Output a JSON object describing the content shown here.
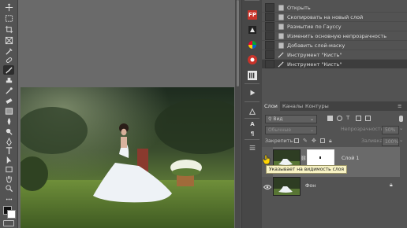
{
  "history": {
    "items": [
      {
        "label": "Открыть",
        "icon": "document-icon"
      },
      {
        "label": "Скопировать на новый слой",
        "icon": "document-icon"
      },
      {
        "label": "Размытие по Гауссу",
        "icon": "document-icon"
      },
      {
        "label": "Изменить основную непрозрачность",
        "icon": "document-icon"
      },
      {
        "label": "Добавить слой-маску",
        "icon": "document-icon"
      },
      {
        "label": "Инструмент \"Кисть\"",
        "icon": "brush-icon"
      },
      {
        "label": "Инструмент \"Кисть\"",
        "icon": "brush-icon",
        "selected": true
      }
    ]
  },
  "dock": {
    "icons": [
      "fp-plugin-icon",
      "effects-icon",
      "color-wheel-icon",
      "adjust-icon",
      "red-badge-icon",
      "filter-icon"
    ],
    "fp_label": "FP",
    "lower_icons": [
      "play-icon",
      "text-a-icon",
      "paragraph-icon",
      "brush-settings-icon"
    ]
  },
  "layers": {
    "tabs": [
      "Слои",
      "Каналы",
      "Контуры"
    ],
    "filter_label": "Вид",
    "blend_mode": "Обычные",
    "opacity_label": "Непрозрачность:",
    "opacity_value": "50%",
    "lock_label": "Закрепить:",
    "fill_label": "Заливка:",
    "fill_value": "100%",
    "rows": [
      {
        "name": "Слой 1",
        "has_mask": true,
        "selected": true
      },
      {
        "name": "Фон",
        "locked": true
      }
    ],
    "tooltip": "Указывает на видимость слоя"
  },
  "colors": {
    "accent_selection": "#636363",
    "tooltip_bg": "#f8f3c4",
    "cursor_yellow": "#ffd400"
  }
}
